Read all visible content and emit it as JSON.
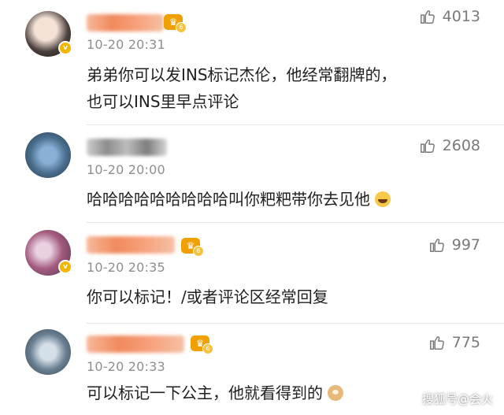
{
  "comments": [
    {
      "time": "10-20 20:31",
      "text_lines": [
        "弟弟你可以发INS标记杰伦，他经常翻牌的，",
        "也可以INS里早点评论"
      ],
      "likes": "4013",
      "emoji": null
    },
    {
      "time": "10-20 20:00",
      "text_lines": [
        "哈哈哈哈哈哈哈哈哈叫你粑粑带你去见他"
      ],
      "likes": "2608",
      "emoji": "laugh-emoji"
    },
    {
      "time": "10-20 20:35",
      "text_lines": [
        "你可以标记！/或者评论区经常回复"
      ],
      "likes": "997",
      "emoji": null
    },
    {
      "time": "10-20 20:33",
      "text_lines": [
        "可以标记一下公主，他就看得到的"
      ],
      "likes": "775",
      "emoji": "doge-emoji"
    }
  ],
  "watermark": "搜狐号@会火",
  "colors": {
    "accent": "#f5b400",
    "muted": "#8e8e8e"
  }
}
